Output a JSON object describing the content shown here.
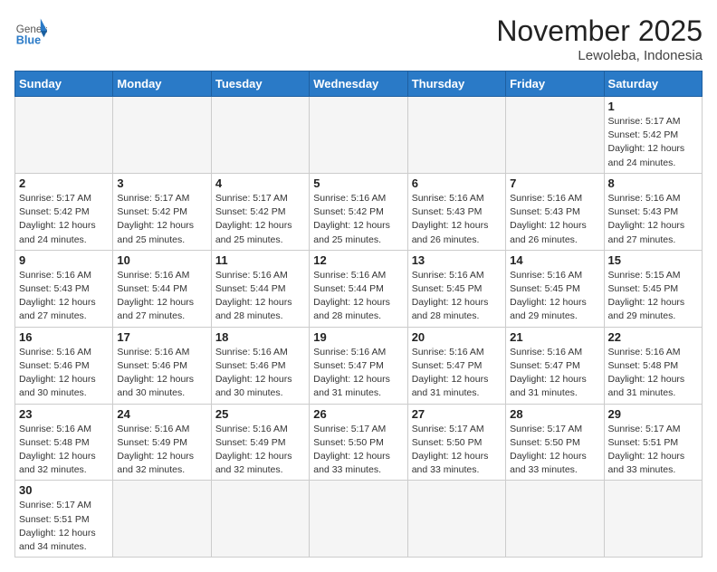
{
  "header": {
    "logo_general": "General",
    "logo_blue": "Blue",
    "month_title": "November 2025",
    "location": "Lewoleba, Indonesia"
  },
  "weekdays": [
    "Sunday",
    "Monday",
    "Tuesday",
    "Wednesday",
    "Thursday",
    "Friday",
    "Saturday"
  ],
  "weeks": [
    [
      {
        "day": "",
        "info": ""
      },
      {
        "day": "",
        "info": ""
      },
      {
        "day": "",
        "info": ""
      },
      {
        "day": "",
        "info": ""
      },
      {
        "day": "",
        "info": ""
      },
      {
        "day": "",
        "info": ""
      },
      {
        "day": "1",
        "info": "Sunrise: 5:17 AM\nSunset: 5:42 PM\nDaylight: 12 hours\nand 24 minutes."
      }
    ],
    [
      {
        "day": "2",
        "info": "Sunrise: 5:17 AM\nSunset: 5:42 PM\nDaylight: 12 hours\nand 24 minutes."
      },
      {
        "day": "3",
        "info": "Sunrise: 5:17 AM\nSunset: 5:42 PM\nDaylight: 12 hours\nand 25 minutes."
      },
      {
        "day": "4",
        "info": "Sunrise: 5:17 AM\nSunset: 5:42 PM\nDaylight: 12 hours\nand 25 minutes."
      },
      {
        "day": "5",
        "info": "Sunrise: 5:16 AM\nSunset: 5:42 PM\nDaylight: 12 hours\nand 25 minutes."
      },
      {
        "day": "6",
        "info": "Sunrise: 5:16 AM\nSunset: 5:43 PM\nDaylight: 12 hours\nand 26 minutes."
      },
      {
        "day": "7",
        "info": "Sunrise: 5:16 AM\nSunset: 5:43 PM\nDaylight: 12 hours\nand 26 minutes."
      },
      {
        "day": "8",
        "info": "Sunrise: 5:16 AM\nSunset: 5:43 PM\nDaylight: 12 hours\nand 27 minutes."
      }
    ],
    [
      {
        "day": "9",
        "info": "Sunrise: 5:16 AM\nSunset: 5:43 PM\nDaylight: 12 hours\nand 27 minutes."
      },
      {
        "day": "10",
        "info": "Sunrise: 5:16 AM\nSunset: 5:44 PM\nDaylight: 12 hours\nand 27 minutes."
      },
      {
        "day": "11",
        "info": "Sunrise: 5:16 AM\nSunset: 5:44 PM\nDaylight: 12 hours\nand 28 minutes."
      },
      {
        "day": "12",
        "info": "Sunrise: 5:16 AM\nSunset: 5:44 PM\nDaylight: 12 hours\nand 28 minutes."
      },
      {
        "day": "13",
        "info": "Sunrise: 5:16 AM\nSunset: 5:45 PM\nDaylight: 12 hours\nand 28 minutes."
      },
      {
        "day": "14",
        "info": "Sunrise: 5:16 AM\nSunset: 5:45 PM\nDaylight: 12 hours\nand 29 minutes."
      },
      {
        "day": "15",
        "info": "Sunrise: 5:15 AM\nSunset: 5:45 PM\nDaylight: 12 hours\nand 29 minutes."
      }
    ],
    [
      {
        "day": "16",
        "info": "Sunrise: 5:16 AM\nSunset: 5:46 PM\nDaylight: 12 hours\nand 30 minutes."
      },
      {
        "day": "17",
        "info": "Sunrise: 5:16 AM\nSunset: 5:46 PM\nDaylight: 12 hours\nand 30 minutes."
      },
      {
        "day": "18",
        "info": "Sunrise: 5:16 AM\nSunset: 5:46 PM\nDaylight: 12 hours\nand 30 minutes."
      },
      {
        "day": "19",
        "info": "Sunrise: 5:16 AM\nSunset: 5:47 PM\nDaylight: 12 hours\nand 31 minutes."
      },
      {
        "day": "20",
        "info": "Sunrise: 5:16 AM\nSunset: 5:47 PM\nDaylight: 12 hours\nand 31 minutes."
      },
      {
        "day": "21",
        "info": "Sunrise: 5:16 AM\nSunset: 5:47 PM\nDaylight: 12 hours\nand 31 minutes."
      },
      {
        "day": "22",
        "info": "Sunrise: 5:16 AM\nSunset: 5:48 PM\nDaylight: 12 hours\nand 31 minutes."
      }
    ],
    [
      {
        "day": "23",
        "info": "Sunrise: 5:16 AM\nSunset: 5:48 PM\nDaylight: 12 hours\nand 32 minutes."
      },
      {
        "day": "24",
        "info": "Sunrise: 5:16 AM\nSunset: 5:49 PM\nDaylight: 12 hours\nand 32 minutes."
      },
      {
        "day": "25",
        "info": "Sunrise: 5:16 AM\nSunset: 5:49 PM\nDaylight: 12 hours\nand 32 minutes."
      },
      {
        "day": "26",
        "info": "Sunrise: 5:17 AM\nSunset: 5:50 PM\nDaylight: 12 hours\nand 33 minutes."
      },
      {
        "day": "27",
        "info": "Sunrise: 5:17 AM\nSunset: 5:50 PM\nDaylight: 12 hours\nand 33 minutes."
      },
      {
        "day": "28",
        "info": "Sunrise: 5:17 AM\nSunset: 5:50 PM\nDaylight: 12 hours\nand 33 minutes."
      },
      {
        "day": "29",
        "info": "Sunrise: 5:17 AM\nSunset: 5:51 PM\nDaylight: 12 hours\nand 33 minutes."
      }
    ],
    [
      {
        "day": "30",
        "info": "Sunrise: 5:17 AM\nSunset: 5:51 PM\nDaylight: 12 hours\nand 34 minutes."
      },
      {
        "day": "",
        "info": ""
      },
      {
        "day": "",
        "info": ""
      },
      {
        "day": "",
        "info": ""
      },
      {
        "day": "",
        "info": ""
      },
      {
        "day": "",
        "info": ""
      },
      {
        "day": "",
        "info": ""
      }
    ]
  ]
}
